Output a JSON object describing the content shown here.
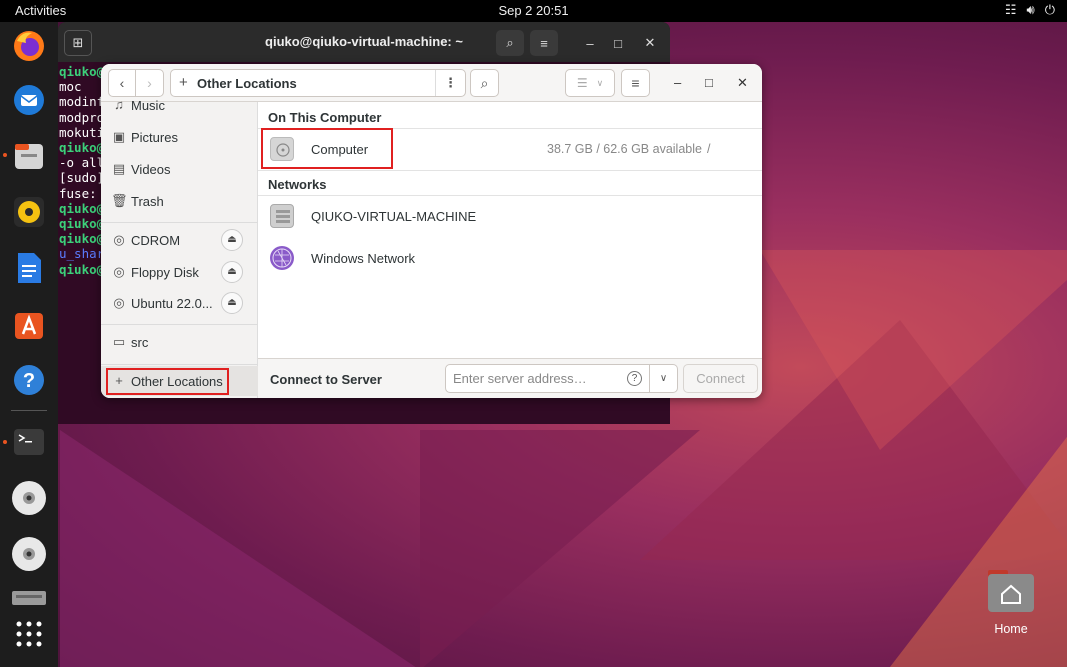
{
  "topbar": {
    "activities": "Activities",
    "clock": "Sep 2  20:51"
  },
  "terminal": {
    "title": "qiuko@qiuko-virtual-machine: ~",
    "lines": [
      {
        "text": "qiuko@",
        "style": "green"
      },
      {
        "text": "moc",
        "style": "plain"
      },
      {
        "text": "modinf",
        "style": "plain"
      },
      {
        "text": "modpro",
        "style": "plain"
      },
      {
        "text": "mokuti",
        "style": "plain"
      },
      {
        "text": "qiuko@",
        "style": "green"
      },
      {
        "text": "-o all",
        "style": "plain"
      },
      {
        "text": "[sudo]",
        "style": "plain"
      },
      {
        "text": "fuse:",
        "style": "plain"
      },
      {
        "text": "qiuko@",
        "style": "green"
      },
      {
        "text": "qiuko@",
        "style": "green"
      },
      {
        "text": "qiuko@",
        "style": "green"
      },
      {
        "text": "u_shar",
        "style": "blue"
      },
      {
        "text": "qiuko@",
        "style": "green"
      }
    ]
  },
  "files": {
    "path_label": "Other Locations",
    "sidebar": {
      "music": "Music",
      "pictures": "Pictures",
      "videos": "Videos",
      "trash": "Trash",
      "cdrom": "CDROM",
      "floppy": "Floppy Disk",
      "ubuntu": "Ubuntu 22.0...",
      "src": "src",
      "other_locations": "Other Locations"
    },
    "on_this_computer": "On This Computer",
    "computer": {
      "label": "Computer",
      "info": "38.7 GB / 62.6 GB available",
      "path": "/"
    },
    "networks": "Networks",
    "network_items": [
      "QIUKO-VIRTUAL-MACHINE",
      "Windows Network"
    ],
    "connect": {
      "label": "Connect to Server",
      "placeholder": "Enter server address…",
      "button": "Connect"
    }
  },
  "desktop": {
    "home_label": "Home"
  },
  "colors": {
    "accent": "#e95420",
    "highlight_box": "#e02020",
    "terminal_bg": "#300a24"
  }
}
